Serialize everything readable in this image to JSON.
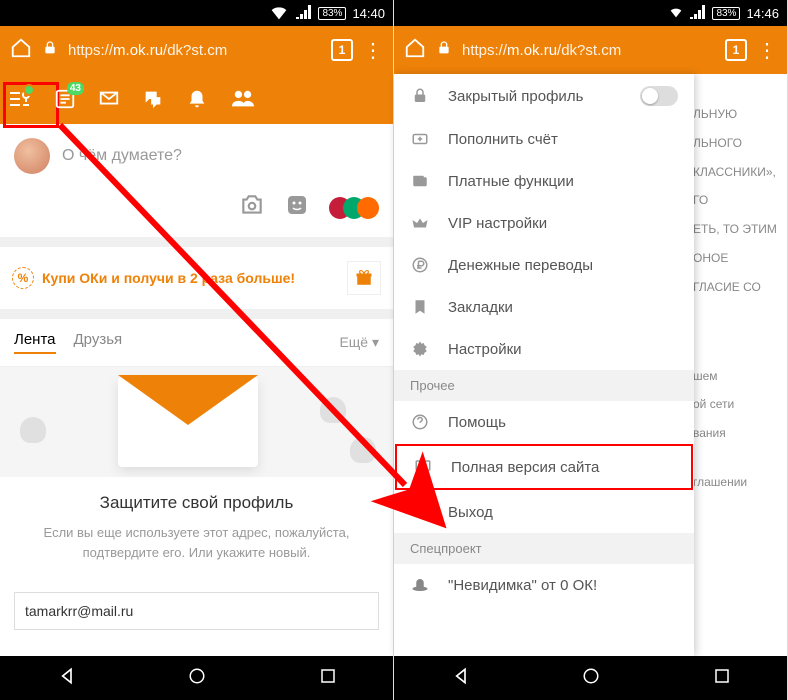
{
  "left": {
    "status": {
      "battery": "83%",
      "time": "14:40"
    },
    "url": {
      "prefix": "https://",
      "domain": "m.ok.ru",
      "path": "/dk?st.cm",
      "tabs": "1"
    },
    "nav": {
      "badge": "43"
    },
    "composer": {
      "placeholder": "О чём думаете?"
    },
    "promo": {
      "text": "Купи ОКи и получи в 2 раза больше!"
    },
    "tabs": {
      "feed": "Лента",
      "friends": "Друзья",
      "more": "Ещё ▾"
    },
    "protect": {
      "title": "Защитите свой профиль",
      "desc": "Если вы еще используете этот адрес, пожалуйста, подтвердите его. Или укажите новый.",
      "email": "tamarkrr@mail.ru"
    }
  },
  "right": {
    "status": {
      "battery": "83%",
      "time": "14:46"
    },
    "url": {
      "prefix": "https://",
      "domain": "m.ok.ru",
      "path": "/dk?st.cm",
      "tabs": "1"
    },
    "drawer": {
      "private": "Закрытый профиль",
      "topup": "Пополнить счёт",
      "paid": "Платные функции",
      "vip": "VIP настройки",
      "transfers": "Денежные переводы",
      "bookmarks": "Закладки",
      "settings": "Настройки",
      "section_other": "Прочее",
      "help": "Помощь",
      "full": "Полная версия сайта",
      "exit": "Выход",
      "section_special": "Спецпроект",
      "invisible": "\"Невидимка\" от 0 ОК!"
    },
    "bg_snippets": [
      "ЛЬНУЮ",
      "ЛЬНОГО",
      "КЛАССНИКИ»,",
      "ГО",
      "ЕТЬ, ТО ЭТИМ",
      "ОНОЕ",
      "ГЛАСИЕ СО",
      "шем",
      "ой сети",
      "вания",
      "глашении"
    ]
  }
}
